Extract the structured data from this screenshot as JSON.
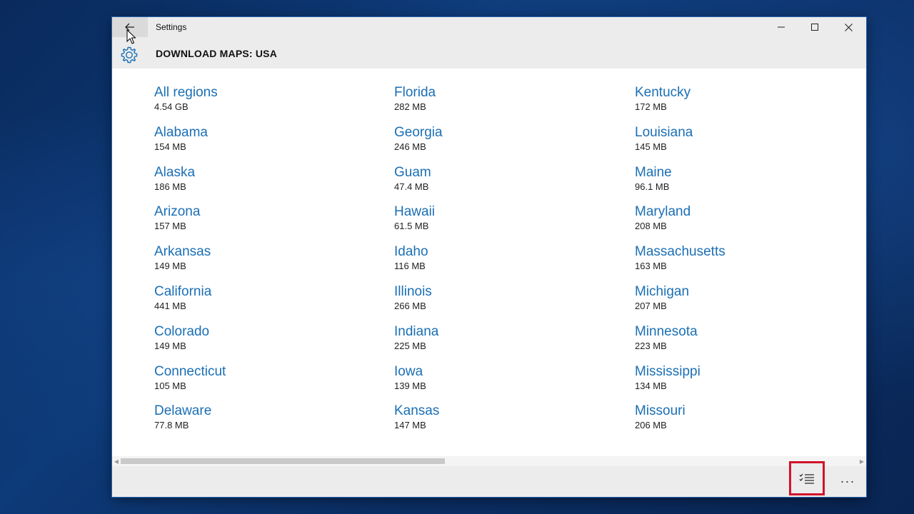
{
  "window": {
    "app_title": "Settings",
    "page_title": "DOWNLOAD MAPS: USA",
    "back_icon": "back-arrow-icon",
    "settings_icon": "gear-icon",
    "controls": [
      "minimize-icon",
      "maximize-icon",
      "close-icon"
    ]
  },
  "columns": [
    [
      {
        "name": "All regions",
        "size": "4.54 GB"
      },
      {
        "name": "Alabama",
        "size": "154 MB"
      },
      {
        "name": "Alaska",
        "size": "186 MB"
      },
      {
        "name": "Arizona",
        "size": "157 MB"
      },
      {
        "name": "Arkansas",
        "size": "149 MB"
      },
      {
        "name": "California",
        "size": "441 MB"
      },
      {
        "name": "Colorado",
        "size": "149 MB"
      },
      {
        "name": "Connecticut",
        "size": "105 MB"
      },
      {
        "name": "Delaware",
        "size": "77.8 MB"
      }
    ],
    [
      {
        "name": "Florida",
        "size": "282 MB"
      },
      {
        "name": "Georgia",
        "size": "246 MB"
      },
      {
        "name": "Guam",
        "size": "47.4 MB"
      },
      {
        "name": "Hawaii",
        "size": "61.5 MB"
      },
      {
        "name": "Idaho",
        "size": "116 MB"
      },
      {
        "name": "Illinois",
        "size": "266 MB"
      },
      {
        "name": "Indiana",
        "size": "225 MB"
      },
      {
        "name": "Iowa",
        "size": "139 MB"
      },
      {
        "name": "Kansas",
        "size": "147 MB"
      }
    ],
    [
      {
        "name": "Kentucky",
        "size": "172 MB"
      },
      {
        "name": "Louisiana",
        "size": "145 MB"
      },
      {
        "name": "Maine",
        "size": "96.1 MB"
      },
      {
        "name": "Maryland",
        "size": "208 MB"
      },
      {
        "name": "Massachusetts",
        "size": "163 MB"
      },
      {
        "name": "Michigan",
        "size": "207 MB"
      },
      {
        "name": "Minnesota",
        "size": "223 MB"
      },
      {
        "name": "Mississippi",
        "size": "134 MB"
      },
      {
        "name": "Missouri",
        "size": "206 MB"
      }
    ]
  ],
  "scrollbar": {
    "position_fraction": 0.44
  },
  "app_bar": {
    "tasks_icon": "checklist-icon",
    "more_glyph": "···",
    "highlight_color": "#d3132a"
  },
  "colors": {
    "link": "#1a6fb5",
    "header_bg": "#ececec"
  }
}
